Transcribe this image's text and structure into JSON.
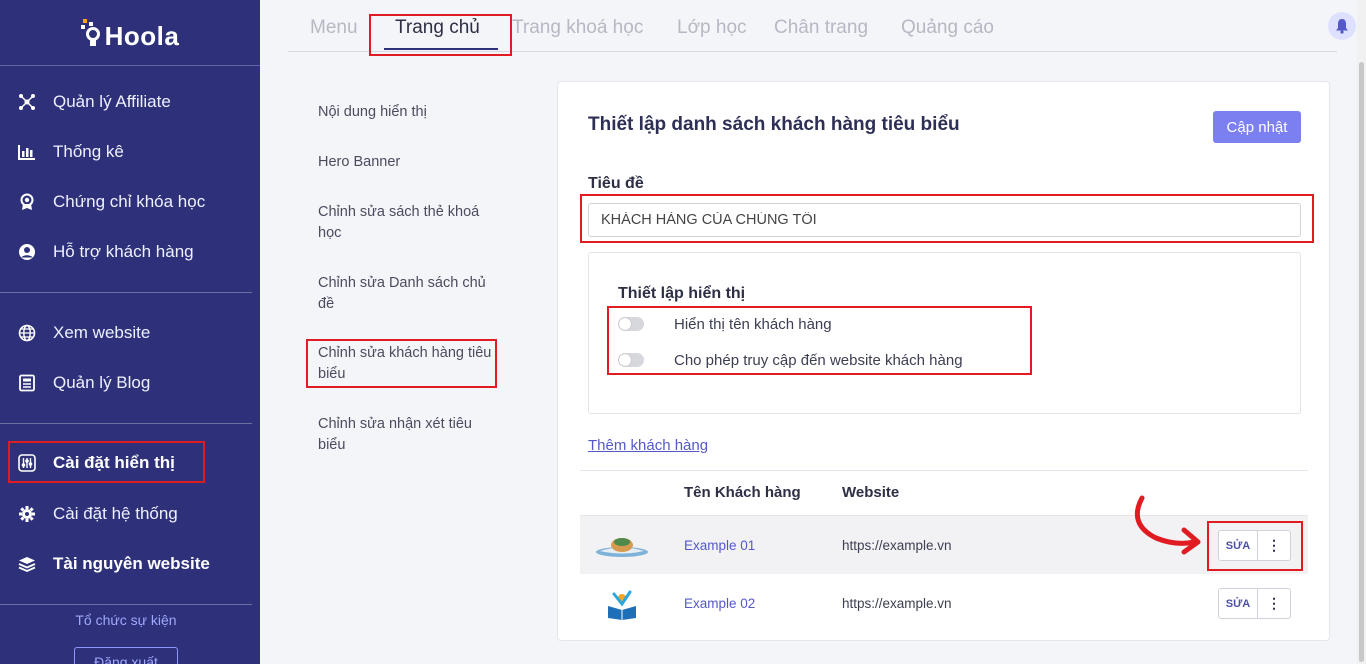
{
  "sidebar": {
    "logo": "Hoola",
    "items": [
      {
        "label": "Quản lý Affiliate",
        "icon": "affiliate-network-icon"
      },
      {
        "label": "Thống kê",
        "icon": "bar-chart-icon"
      },
      {
        "label": "Chứng chỉ khóa học",
        "icon": "certificate-badge-icon"
      },
      {
        "label": "Hỗ trợ khách hàng",
        "icon": "user-circle-icon"
      },
      {
        "label": "Xem website",
        "icon": "globe-icon"
      },
      {
        "label": "Quản lý Blog",
        "icon": "newspaper-icon"
      },
      {
        "label": "Cài đặt hiển thị",
        "icon": "sliders-icon"
      },
      {
        "label": "Cài đặt hệ thống",
        "icon": "gear-icon"
      },
      {
        "label": "Tài nguyên website",
        "icon": "layers-icon"
      }
    ],
    "event_link": "Tổ chức sự kiện",
    "logout": "Đăng xuất"
  },
  "tabs": [
    "Menu",
    "Trang chủ",
    "Trang khoá học",
    "Lớp học",
    "Chân trang",
    "Quảng cáo"
  ],
  "active_tab": "Trang chủ",
  "submenu": [
    "Nội dung hiển thị",
    "Hero Banner",
    "Chỉnh sửa sách thẻ khoá học",
    "Chỉnh sửa Danh sách chủ đề",
    "Chỉnh sửa khách hàng tiêu biểu",
    "Chỉnh sửa nhận xét tiêu biểu"
  ],
  "main": {
    "title": "Thiết lập danh sách khách hàng tiêu biểu",
    "update_button": "Cập nhật",
    "heading_label": "Tiêu đề",
    "heading_value": "KHÁCH HÀNG CỦA CHÚNG TÔI",
    "display_settings": {
      "title": "Thiết lập hiển thị",
      "toggles": [
        {
          "label": "Hiển thị tên khách hàng",
          "on": false
        },
        {
          "label": "Cho phép truy cập đến website khách hàng",
          "on": false
        }
      ]
    },
    "add_customer": "Thêm khách hàng",
    "table": {
      "headers": [
        "Tên Khách hàng",
        "Website"
      ],
      "rows": [
        {
          "name": "Example 01",
          "website": "https://example.vn",
          "logo": "book-island-logo"
        },
        {
          "name": "Example 02",
          "website": "https://example.vn",
          "logo": "kid-reading-book-logo"
        }
      ],
      "edit_label": "SỬA",
      "more_label": "⋮"
    }
  },
  "colors": {
    "sidebar_bg": "#2e3179",
    "accent": "#7b7ff0",
    "link": "#5559c8",
    "highlight": "#e11b22"
  }
}
